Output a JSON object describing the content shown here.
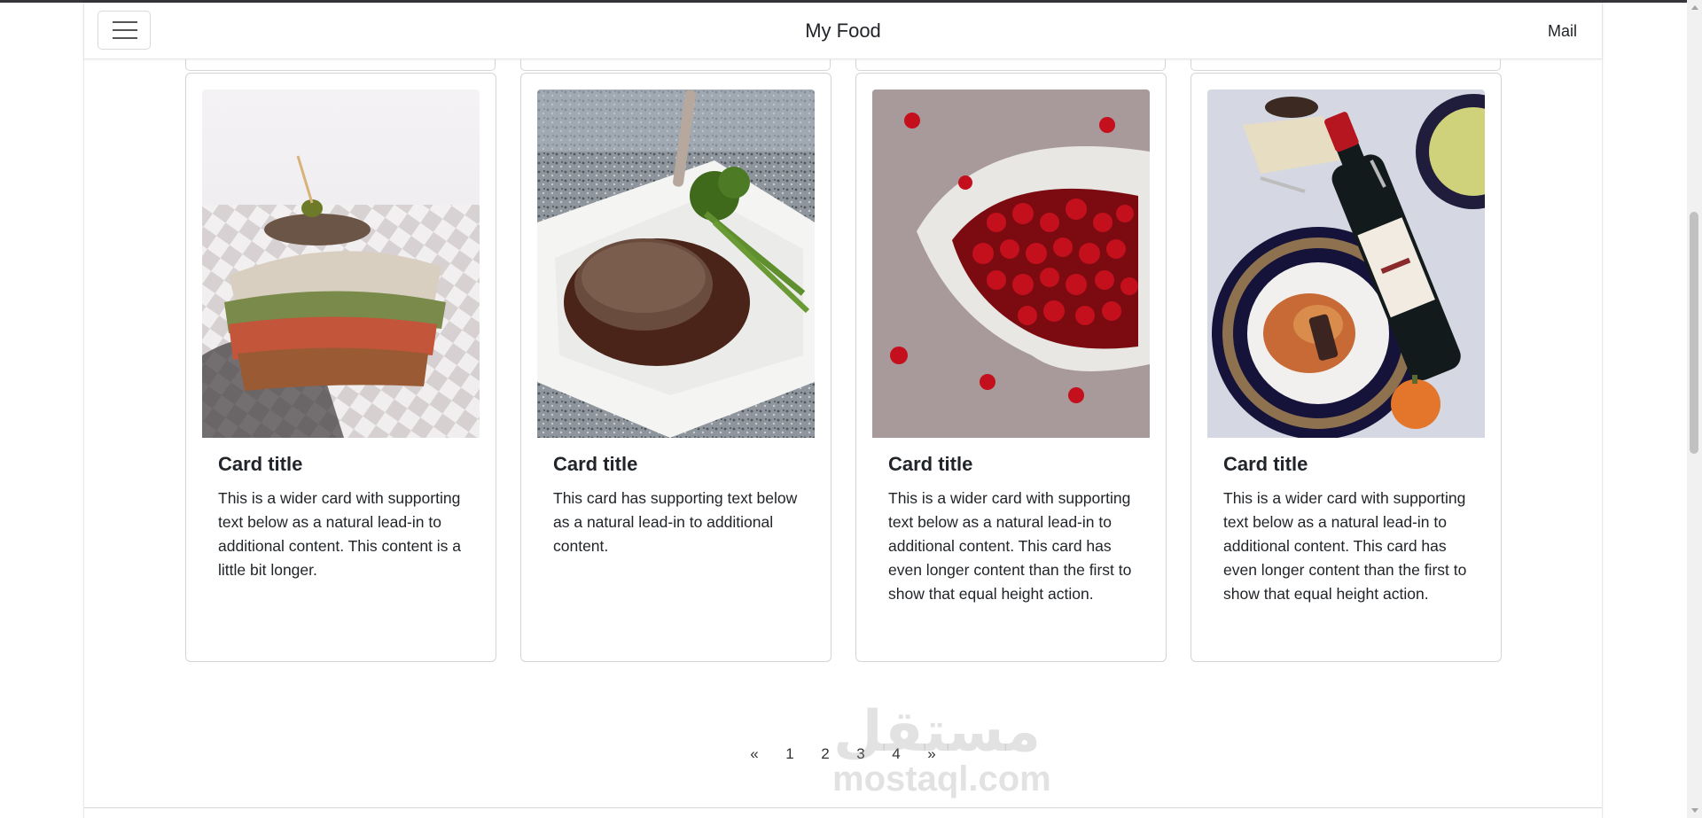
{
  "navbar": {
    "brand": "My Food",
    "mail_link": "Mail",
    "menu_icon": "hamburger-menu-icon"
  },
  "cards": [
    {
      "title": "Card title",
      "text": "This is a wider card with supporting text below as a natural lead-in to additional content. This content is a little bit longer.",
      "image": "sandwich-photo"
    },
    {
      "title": "Card title",
      "text": "This card has supporting text below as a natural lead-in to additional content.",
      "image": "steak-photo"
    },
    {
      "title": "Card title",
      "text": "This is a wider card with supporting text below as a natural lead-in to additional content. This card has even longer content than the first to show that equal height action.",
      "image": "cherries-photo"
    },
    {
      "title": "Card title",
      "text": "This is a wider card with supporting text below as a natural lead-in to additional content. This card has even longer content than the first to show that equal height action.",
      "image": "pasta-wine-photo"
    }
  ],
  "pagination": {
    "prev": "«",
    "pages": [
      "1",
      "2",
      "3",
      "4"
    ],
    "next": "»"
  },
  "watermark": {
    "arabic": "مستقل",
    "latin": "mostaql.com"
  }
}
